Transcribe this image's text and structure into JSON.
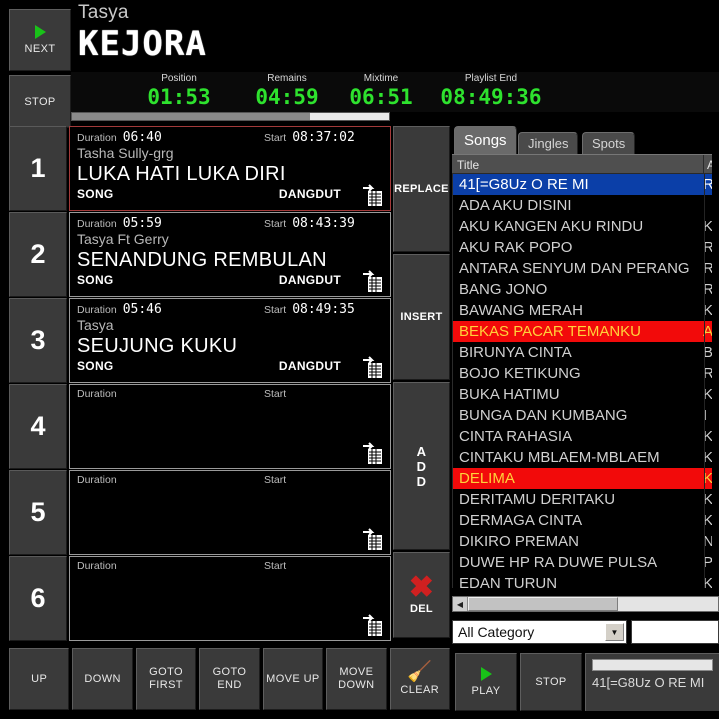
{
  "transport": {
    "next_label": "NEXT",
    "stop_label": "STOP",
    "play_icon": "play-triangle-icon"
  },
  "now_playing": {
    "artist": "Tasya",
    "title": "KEJORA",
    "progress_percent": 75
  },
  "timers": [
    {
      "label": "Position",
      "value": "01:53"
    },
    {
      "label": "Remains",
      "value": "04:59"
    },
    {
      "label": "Mixtime",
      "value": "06:51"
    },
    {
      "label": "Playlist End",
      "value": "08:49:36"
    }
  ],
  "playlist": {
    "duration_label": "Duration",
    "start_label": "Start",
    "rows": [
      {
        "num": "1",
        "duration": "06:40",
        "start": "08:37:02",
        "artist": "Tasha Sully-grg",
        "title": "LUKA HATI LUKA DIRI",
        "type": "SONG",
        "genre": "DANGDUT",
        "active": true
      },
      {
        "num": "2",
        "duration": "05:59",
        "start": "08:43:39",
        "artist": "Tasya Ft Gerry",
        "title": "SENANDUNG REMBULAN",
        "type": "SONG",
        "genre": "DANGDUT",
        "active": false
      },
      {
        "num": "3",
        "duration": "05:46",
        "start": "08:49:35",
        "artist": "Tasya",
        "title": "SEUJUNG KUKU",
        "type": "SONG",
        "genre": "DANGDUT",
        "active": false
      },
      {
        "num": "4",
        "duration": "",
        "start": "",
        "artist": "",
        "title": "",
        "type": "",
        "genre": "",
        "active": false
      },
      {
        "num": "5",
        "duration": "",
        "start": "",
        "artist": "",
        "title": "",
        "type": "",
        "genre": "",
        "active": false
      },
      {
        "num": "6",
        "duration": "",
        "start": "",
        "artist": "",
        "title": "",
        "type": "",
        "genre": "",
        "active": false
      }
    ]
  },
  "actions": {
    "replace": "REPLACE",
    "insert": "INSERT",
    "add_line1": "A",
    "add_line2": "D",
    "add_line3": "D",
    "del": "DEL",
    "del_icon": "red-x-icon"
  },
  "library": {
    "tabs": [
      {
        "label": "Songs",
        "selected": true
      },
      {
        "label": "Jingles",
        "selected": false
      },
      {
        "label": "Spots",
        "selected": false
      }
    ],
    "columns": {
      "title": "Title",
      "artist": "A"
    },
    "rows": [
      {
        "title": "41[=G8Uz O RE MI",
        "artist": "R",
        "state": "selected"
      },
      {
        "title": "ADA AKU DISINI",
        "artist": "",
        "state": "normal"
      },
      {
        "title": "AKU KANGEN AKU RINDU",
        "artist": "K",
        "state": "normal"
      },
      {
        "title": "AKU RAK POPO",
        "artist": "R",
        "state": "normal"
      },
      {
        "title": "ANTARA SENYUM DAN PERANG",
        "artist": "R",
        "state": "normal"
      },
      {
        "title": "BANG JONO",
        "artist": "R",
        "state": "normal"
      },
      {
        "title": "BAWANG MERAH",
        "artist": "K",
        "state": "normal"
      },
      {
        "title": "BEKAS PACAR TEMANKU",
        "artist": "A",
        "state": "marked"
      },
      {
        "title": "BIRUNYA CINTA",
        "artist": "B",
        "state": "normal"
      },
      {
        "title": "BOJO KETIKUNG",
        "artist": "R",
        "state": "normal"
      },
      {
        "title": "BUKA HATIMU",
        "artist": "K",
        "state": "normal"
      },
      {
        "title": "BUNGA DAN KUMBANG",
        "artist": "I",
        "state": "normal"
      },
      {
        "title": "CINTA RAHASIA",
        "artist": "K",
        "state": "normal"
      },
      {
        "title": "CINTAKU MBLAEM-MBLAEM",
        "artist": "K",
        "state": "normal"
      },
      {
        "title": "DELIMA",
        "artist": "K",
        "state": "marked"
      },
      {
        "title": "DERITAMU DERITAKU",
        "artist": "K",
        "state": "normal"
      },
      {
        "title": "DERMAGA CINTA",
        "artist": "K",
        "state": "normal"
      },
      {
        "title": "DIKIRO PREMAN",
        "artist": "N",
        "state": "normal"
      },
      {
        "title": "DUWE HP RA DUWE PULSA",
        "artist": "P",
        "state": "normal"
      },
      {
        "title": "EDAN TURUN",
        "artist": "K",
        "state": "normal"
      }
    ],
    "category_filter": "All Category",
    "search_value": "",
    "search_placeholder": "",
    "play_label": "PLAY",
    "stop_label": "STOP",
    "preview_track": "41[=G8Uz O RE MI"
  },
  "bottom_buttons": [
    {
      "line1": "UP",
      "line2": ""
    },
    {
      "line1": "DOWN",
      "line2": ""
    },
    {
      "line1": "GOTO",
      "line2": "FIRST"
    },
    {
      "line1": "GOTO END",
      "line2": ""
    },
    {
      "line1": "MOVE UP",
      "line2": ""
    },
    {
      "line1": "MOVE",
      "line2": "DOWN"
    },
    {
      "line1": "CLEAR",
      "line2": ""
    }
  ],
  "colors": {
    "accent_green": "#2ee22e",
    "selected_blue": "#0b3fa8",
    "marked_red": "#f20a0a",
    "marked_text": "#ffd23a",
    "panel_gray": "#3a3a3a"
  }
}
